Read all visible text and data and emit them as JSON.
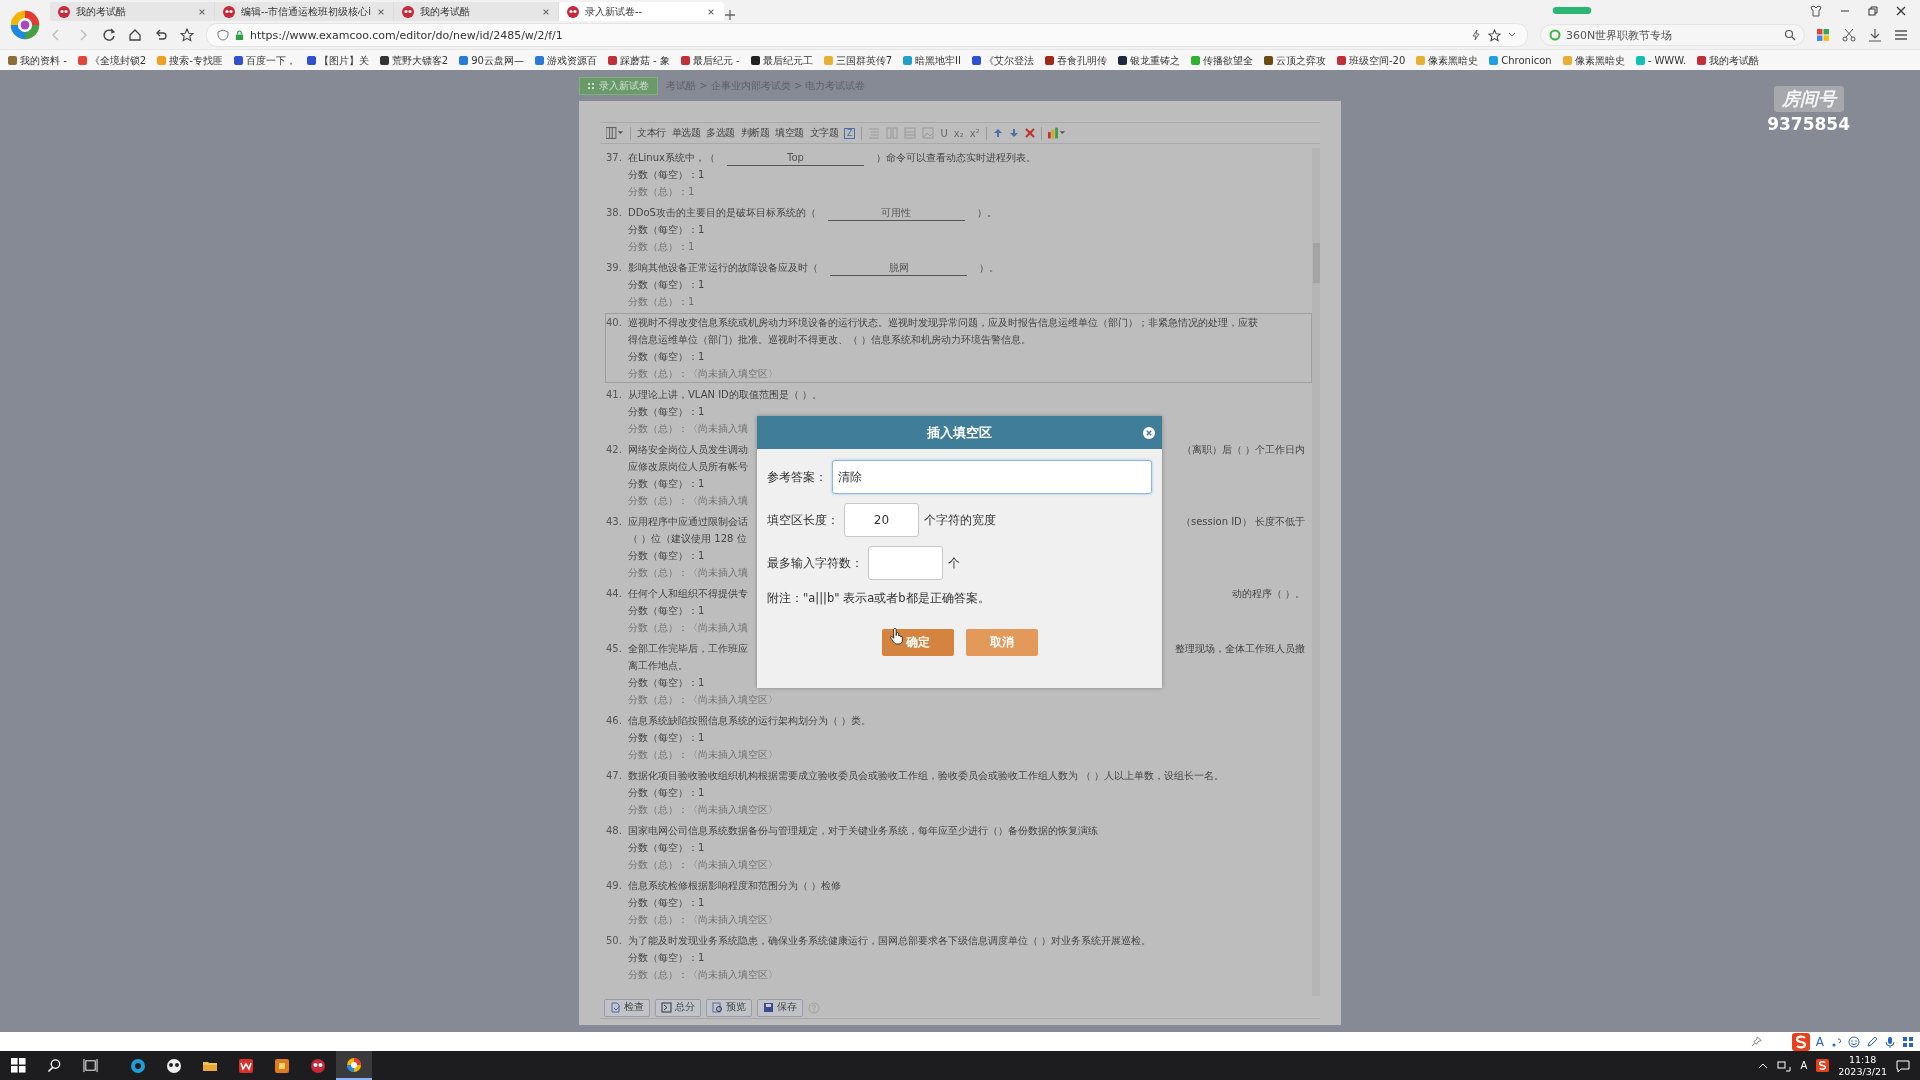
{
  "browser": {
    "tabs": [
      {
        "title": "我的考试酷",
        "selected": false
      },
      {
        "title": "编辑--市信通运检班初级核心i",
        "selected": false
      },
      {
        "title": "我的考试酷",
        "selected": false
      },
      {
        "title": "录入新试卷--",
        "selected": true
      }
    ],
    "address": "https://www.examcoo.com/editor/do/new/id/2485/w/2/f/1",
    "search_box": "360N世界职教节专场",
    "bookmarks": [
      {
        "label": "我的资料 -",
        "color": "#8a6d3b"
      },
      {
        "label": "《全境封锁2",
        "color": "#e0463c"
      },
      {
        "label": "搜索-专找匪",
        "color": "#f0a020"
      },
      {
        "label": "百度一下，",
        "color": "#3050d0"
      },
      {
        "label": "【图片】关",
        "color": "#3050d0"
      },
      {
        "label": "荒野大镖客2",
        "color": "#333333"
      },
      {
        "label": "90云盘网—",
        "color": "#2a7ad8"
      },
      {
        "label": "游戏资源百",
        "color": "#2a7ad8"
      },
      {
        "label": "踩蘑菇 - 象",
        "color": "#c0303a"
      },
      {
        "label": "最后纪元 -",
        "color": "#c0303a"
      },
      {
        "label": "最后纪元工",
        "color": "#222222"
      },
      {
        "label": "三国群英传7",
        "color": "#e8b030"
      },
      {
        "label": "暗黑地牢II",
        "color": "#20a0c8"
      },
      {
        "label": "《艾尔登法",
        "color": "#3050d0"
      },
      {
        "label": "吞食孔明传",
        "color": "#a02818"
      },
      {
        "label": "银龙重铸之",
        "color": "#202840"
      },
      {
        "label": "传播欲望全",
        "color": "#30b030"
      },
      {
        "label": "云顶之弈攻",
        "color": "#6a4a10"
      },
      {
        "label": "班级空间-20",
        "color": "#c0303a"
      },
      {
        "label": "像素黑暗史",
        "color": "#e8b030"
      },
      {
        "label": "Chronicon",
        "color": "#20a0e0"
      },
      {
        "label": "像素黑暗史",
        "color": "#e8b030"
      },
      {
        "label": "- WWW.",
        "color": "#10c0b0"
      },
      {
        "label": "我的考试酷",
        "color": "#c0303a"
      }
    ]
  },
  "breadcrumb": {
    "tag": "录入新试卷",
    "path": "考试酷 > 企事业内部考试类 > 电力考试试卷"
  },
  "room_badge": {
    "label": "房间号",
    "number": "9375854"
  },
  "toolbar": {
    "question_types": [
      "文本行",
      "单选题",
      "多选题",
      "判断题",
      "填空题",
      "文字题"
    ],
    "badge": "Z",
    "format_buttons": [
      {
        "label": "U",
        "disabled": true
      },
      {
        "label": "x₂",
        "disabled": true
      },
      {
        "label": "x²",
        "disabled": true
      }
    ]
  },
  "questions": [
    {
      "number": "37.",
      "selected": false,
      "lines": [
        {
          "parts": [
            {
              "kind": "text",
              "text": "在Linux系统中，（"
            },
            {
              "kind": "blank",
              "text": "Top"
            },
            {
              "kind": "text",
              "text": "）命令可以查看动态实时进程列表。"
            }
          ]
        }
      ],
      "score_each": "分数（每空）：1",
      "score_total": "分数（总）：1"
    },
    {
      "number": "38.",
      "selected": false,
      "lines": [
        {
          "parts": [
            {
              "kind": "text",
              "text": "DDoS攻击的主要目的是破坏目标系统的（"
            },
            {
              "kind": "blank",
              "text": "可用性"
            },
            {
              "kind": "text",
              "text": "）。"
            }
          ]
        }
      ],
      "score_each": "分数（每空）：1",
      "score_total": "分数（总）：1"
    },
    {
      "number": "39.",
      "selected": false,
      "lines": [
        {
          "parts": [
            {
              "kind": "text",
              "text": "影响其他设备正常运行的故障设备应及时（"
            },
            {
              "kind": "blank",
              "text": "脱网"
            },
            {
              "kind": "text",
              "text": "）。"
            }
          ]
        }
      ],
      "score_each": "分数（每空）：1",
      "score_total": "分数（总）：1"
    },
    {
      "number": "40.",
      "selected": true,
      "lines": [
        {
          "parts": [
            {
              "kind": "text",
              "text": "巡视时不得改变信息系统或机房动力环境设备的运行状态。巡视时发现异常问题，应及时报告信息运维单位（部门）；非紧急情况的处理，应获"
            }
          ]
        },
        {
          "parts": [
            {
              "kind": "text",
              "text": "得信息运维单位（部门）批准。巡视时不得更改、（ ）信息系统和机房动力环境告警信息。"
            }
          ]
        }
      ],
      "score_each": "分数（每空）：1",
      "score_total": "分数（总）：〈尚未插入填空区〉"
    },
    {
      "number": "41.",
      "selected": false,
      "lines": [
        {
          "parts": [
            {
              "kind": "text",
              "text": "从理论上讲，VLAN ID的取值范围是（ ）。"
            }
          ]
        }
      ],
      "score_each": "分数（每空）：1",
      "score_total": "分数（总）：〈尚未插入填"
    },
    {
      "number": "42.",
      "selected": false,
      "lines": [
        {
          "parts": [
            {
              "kind": "text",
              "text": "网络安全岗位人员发生调动"
            }
          ],
          "right": "（离职）后（ ）个工作日内"
        },
        {
          "parts": [
            {
              "kind": "text",
              "text": "应修改原岗位人员所有帐号"
            }
          ]
        }
      ],
      "score_each": "分数（每空）：1",
      "score_total": "分数（总）：〈尚未插入填"
    },
    {
      "number": "43.",
      "selected": false,
      "lines": [
        {
          "parts": [
            {
              "kind": "text",
              "text": "应用程序中应通过限制会话"
            }
          ],
          "right": "（session ID） 长度不低于"
        },
        {
          "parts": [
            {
              "kind": "text",
              "text": "（ ）位（建议使用 128 位"
            }
          ]
        }
      ],
      "score_each": "分数（每空）：1",
      "score_total": "分数（总）：〈尚未插入填"
    },
    {
      "number": "44.",
      "selected": false,
      "lines": [
        {
          "parts": [
            {
              "kind": "text",
              "text": "任何个人和组织不得提供专"
            }
          ],
          "right": "动的程序（ ）。"
        }
      ],
      "score_each": "分数（每空）：1",
      "score_total": "分数（总）：〈尚未插入填"
    },
    {
      "number": "45.",
      "selected": false,
      "lines": [
        {
          "parts": [
            {
              "kind": "text",
              "text": "全部工作完毕后，工作班应"
            }
          ],
          "right": "整理现场，全体工作班人员撤"
        },
        {
          "parts": [
            {
              "kind": "text",
              "text": "离工作地点。"
            }
          ]
        }
      ],
      "score_each": "分数（每空）：1",
      "score_total": "分数（总）：〈尚未插入填空区〉"
    },
    {
      "number": "46.",
      "selected": false,
      "lines": [
        {
          "parts": [
            {
              "kind": "text",
              "text": "信息系统缺陷按照信息系统的运行架构划分为（ ）类。"
            }
          ]
        }
      ],
      "score_each": "分数（每空）：1",
      "score_total": "分数（总）：〈尚未插入填空区〉"
    },
    {
      "number": "47.",
      "selected": false,
      "lines": [
        {
          "parts": [
            {
              "kind": "text",
              "text": "数据化项目验收验收组织机构根据需要成立验收委员会或验收工作组，验收委员会或验收工作组人数为 （ ）人以上单数，设组长一名。"
            }
          ]
        }
      ],
      "score_each": "分数（每空）：1",
      "score_total": "分数（总）：〈尚未插入填空区〉"
    },
    {
      "number": "48.",
      "selected": false,
      "lines": [
        {
          "parts": [
            {
              "kind": "text",
              "text": "国家电网公司信息系统数据备份与管理规定，对于关键业务系统，每年应至少进行（）备份数据的恢复演练"
            }
          ]
        }
      ],
      "score_each": "分数（每空）：1",
      "score_total": "分数（总）：〈尚未插入填空区〉"
    },
    {
      "number": "49.",
      "selected": false,
      "lines": [
        {
          "parts": [
            {
              "kind": "text",
              "text": "信息系统检修根据影响程度和范围分为（ ）检修"
            }
          ]
        }
      ],
      "score_each": "分数（每空）：1",
      "score_total": "分数（总）：〈尚未插入填空区〉"
    },
    {
      "number": "50.",
      "selected": false,
      "lines": [
        {
          "parts": [
            {
              "kind": "text",
              "text": "为了能及时发现业务系统隐患，确保业务系统健康运行，国网总部要求各下级信息调度单位（ ）对业务系统开展巡检。"
            }
          ]
        }
      ],
      "score_each": "分数（每空）：1",
      "score_total": "分数（总）：〈尚未插入填空区〉"
    }
  ],
  "footer_buttons": [
    "检查",
    "总分",
    "预览",
    "保存"
  ],
  "dialog": {
    "title": "插入填空区",
    "fields": [
      {
        "label": "参考答案：",
        "value": "清除",
        "focused": true
      },
      {
        "label": "填空区长度：",
        "value": "20",
        "suffix": "个字符的宽度",
        "focused": false
      },
      {
        "label": "最多输入字符数：",
        "suffix": "个",
        "focused": false
      }
    ],
    "note": "附注：\"a|||b\" 表示a或者b都是正确答案。",
    "buttons": [
      {
        "label": "确定",
        "kind": "primary"
      },
      {
        "label": "取消",
        "kind": "secondary"
      }
    ]
  },
  "ime_bar": {
    "mode": "A"
  },
  "taskbar": {
    "apps": [
      {
        "kind": "edge",
        "selected": false
      },
      {
        "kind": "panda",
        "selected": false
      },
      {
        "kind": "folder",
        "selected": false
      },
      {
        "kind": "wps",
        "selected": false
      },
      {
        "kind": "game",
        "selected": false
      },
      {
        "kind": "exam",
        "selected": false
      },
      {
        "kind": "browser",
        "selected": true
      }
    ],
    "ime": "A",
    "time": "11:18",
    "date": "2023/3/21"
  }
}
